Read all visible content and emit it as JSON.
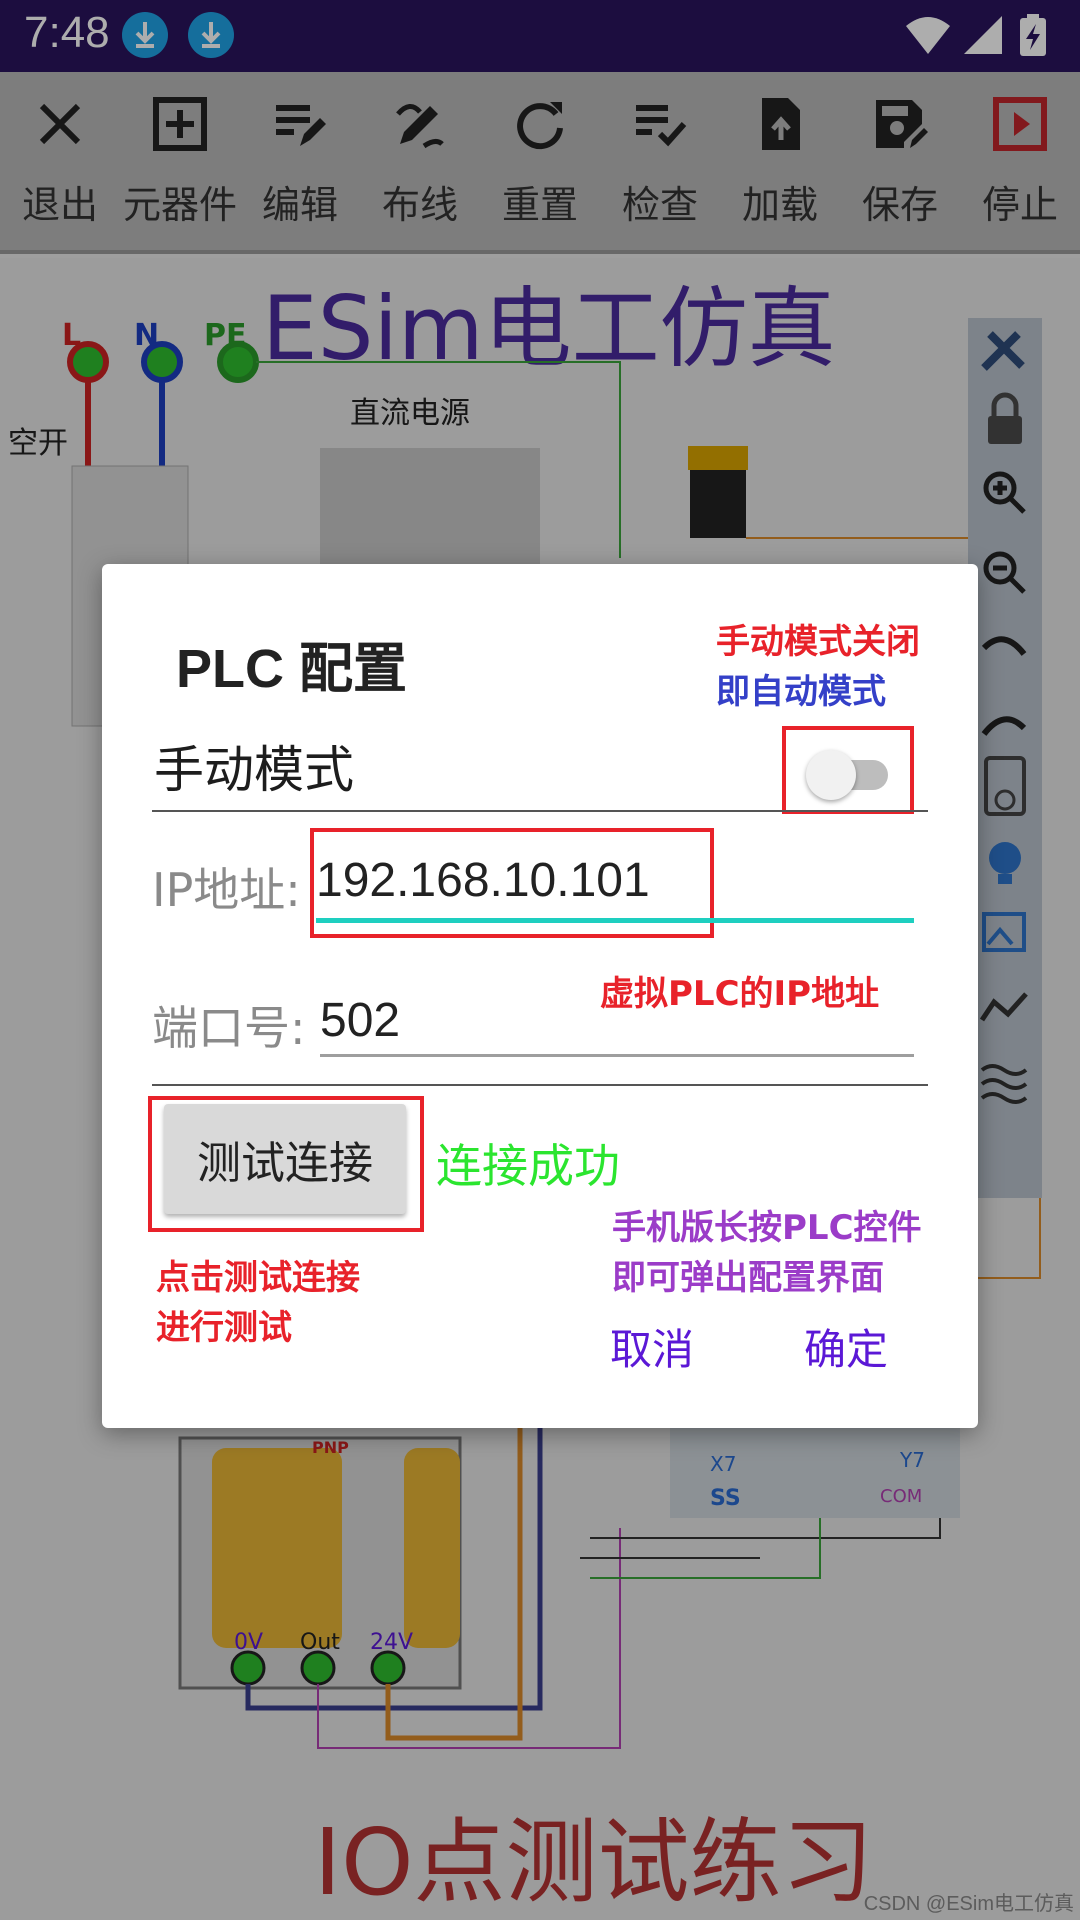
{
  "status_bar": {
    "time": "7:48",
    "icons": [
      "download-icon",
      "download-icon",
      "wifi-icon",
      "signal-icon",
      "battery-charging-icon"
    ]
  },
  "toolbar": {
    "items": [
      {
        "label": "退出",
        "icon": "close-icon"
      },
      {
        "label": "元器件",
        "icon": "add-box-icon"
      },
      {
        "label": "编辑",
        "icon": "edit-list-icon"
      },
      {
        "label": "布线",
        "icon": "draw-icon"
      },
      {
        "label": "重置",
        "icon": "refresh-icon"
      },
      {
        "label": "检查",
        "icon": "checklist-icon"
      },
      {
        "label": "加载",
        "icon": "upload-file-icon"
      },
      {
        "label": "保存",
        "icon": "save-edit-icon"
      },
      {
        "label": "停止",
        "icon": "stop-play-icon"
      }
    ]
  },
  "canvas": {
    "banner": "ESim电工仿真",
    "bottom_banner": "IO点测试练习",
    "labels": {
      "L": "L",
      "N": "N",
      "PE": "PE",
      "breaker": "空开",
      "dc_power": "直流电源",
      "pnp": "PNP",
      "v0": "0V",
      "out": "Out",
      "v24": "24V",
      "x7": "X7",
      "ss": "SS",
      "y7": "Y7",
      "com": "COM"
    },
    "colors": {
      "banner": "#4a2c9c",
      "bottom_banner": "#b33333"
    }
  },
  "dialog": {
    "title": "PLC 配置",
    "note_manual_off": "手动模式关闭",
    "note_auto": "即自动模式",
    "manual_mode_label": "手动模式",
    "manual_mode_on": false,
    "ip_label": "IP地址:",
    "ip_value": "192.168.10.101",
    "note_virtual_ip": "虚拟PLC的IP地址",
    "port_label": "端口号:",
    "port_value": "502",
    "test_button": "测试连接",
    "status": "连接成功",
    "note_long_press_1": "手机版长按PLC控件",
    "note_long_press_2": "即可弹出配置界面",
    "note_click_test_1": "点击测试连接",
    "note_click_test_2": "进行测试",
    "cancel": "取消",
    "confirm": "确定",
    "colors": {
      "highlight": "#e8222a",
      "accent": "#1ecfc0",
      "action": "#5b18d6",
      "success": "#2be52f"
    }
  },
  "watermark": "CSDN @ESim电工仿真"
}
